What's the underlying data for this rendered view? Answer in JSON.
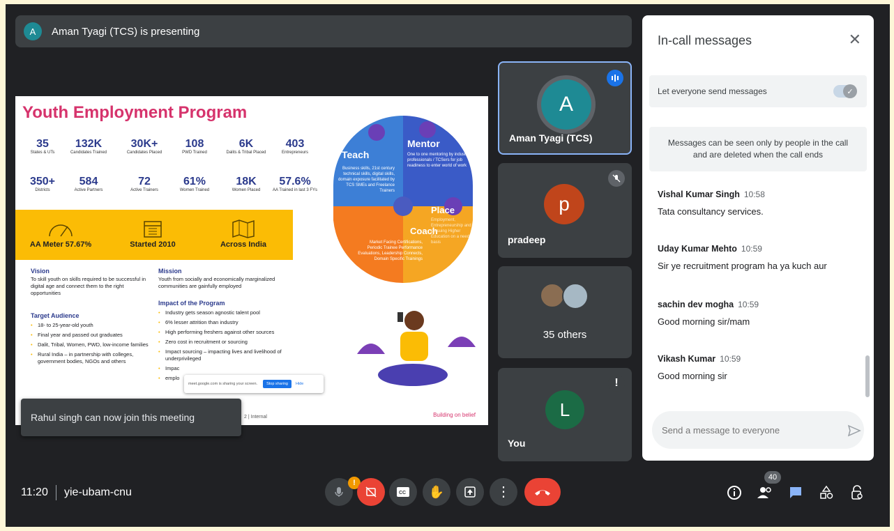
{
  "presenting": {
    "avatar_letter": "A",
    "text": "Aman Tyagi (TCS) is presenting"
  },
  "slide": {
    "title": "Youth Employment Program",
    "stats_row1": [
      {
        "value": "35",
        "label": "States & UTs"
      },
      {
        "value": "132K",
        "label": "Candidates Trained"
      },
      {
        "value": "30K+",
        "label": "Candidates Placed"
      },
      {
        "value": "108",
        "label": "PWD Trained"
      },
      {
        "value": "6K",
        "label": "Dalits & Tribal Placed"
      },
      {
        "value": "403",
        "label": "Entrepreneurs"
      }
    ],
    "stats_row2": [
      {
        "value": "350+",
        "label": "Districts"
      },
      {
        "value": "584",
        "label": "Active Partners"
      },
      {
        "value": "72",
        "label": "Active Trainers"
      },
      {
        "value": "61%",
        "label": "Women Trained"
      },
      {
        "value": "18K",
        "label": "Women Placed"
      },
      {
        "value": "57.6%",
        "label": "AA Trained in last 3 FYs"
      }
    ],
    "band": [
      "AA Meter 57.67%",
      "Started 2010",
      "Across India"
    ],
    "vision_h": "Vision",
    "vision_p": "To skill youth on skills required to be successful in digital age and connect them to the right opportunities",
    "target_h": "Target Audience",
    "target_items": [
      "18- to 25-year-old youth",
      "Final year and passed out graduates",
      "Dalit, Tribal, Women, PWD, low-income families",
      "Rural India – in partnership with colleges, government bodies, NGOs and others"
    ],
    "mission_h": "Mission",
    "mission_p": "Youth from socially and economically marginalized communities are gainfully employed",
    "impact_h": "Impact of the Program",
    "impact_items": [
      "Industry gets season agnostic talent pool",
      "6% lesser attrition than industry",
      "High performing freshers against other sources",
      "Zero cost in recruitment or sourcing",
      "Impact sourcing – impacting lives and livelihood of underprivileged",
      "Impac",
      "emplo"
    ],
    "puzzle": {
      "teach": "Teach",
      "teach_p": "Business skills, 21st century technical skills, digital skills, domain exposure facilitated by TCS SMEs and Freelance Trainers",
      "mentor": "Mentor",
      "mentor_p": "One to one mentoring by industry professionals / TCSers for job readiness to enter world of work",
      "coach": "Coach",
      "coach_p": "Market Facing Certifications, Periodic Trainee Performance Evaluations, Leadership Connects, Domain Specific Trainings",
      "place": "Place",
      "place_p": "Employment, Entrepreneurship and pursuing Higher Education on a need basis"
    },
    "page_num": "2",
    "internal": "Internal",
    "belief": "Building on belief",
    "share_text": "meet.google.com is sharing your screen.",
    "share_stop": "Stop sharing",
    "share_hide": "Hide"
  },
  "tiles": [
    {
      "name": "Aman Tyagi (TCS)",
      "letter": "A",
      "color": "#1e8a94"
    },
    {
      "name": "pradeep",
      "letter": "p",
      "color": "#c0451b"
    },
    {
      "name": "35 others"
    },
    {
      "name": "You",
      "letter": "L",
      "color": "#1b6b45"
    }
  ],
  "chat": {
    "title": "In-call messages",
    "toggle_label": "Let everyone send messages",
    "info": "Messages can be seen only by people in the call and are deleted when the call ends",
    "messages": [
      {
        "sender": "Vishal Kumar Singh",
        "time": "10:58",
        "text": "Tata consultancy services."
      },
      {
        "sender": "Uday Kumar Mehto",
        "time": "10:59",
        "text": "Sir ye recruitment program ha ya kuch aur"
      },
      {
        "sender": "sachin dev mogha",
        "time": "10:59",
        "text": "Good morning sir/mam"
      },
      {
        "sender": "Vikash Kumar",
        "time": "10:59",
        "text": "Good morning sir"
      }
    ],
    "placeholder": "Send a message to everyone"
  },
  "toast": "Rahul singh can now join this meeting",
  "meeting": {
    "time": "11:20",
    "code": "yie-ubam-cnu",
    "people_count": "40",
    "warn": "!"
  }
}
